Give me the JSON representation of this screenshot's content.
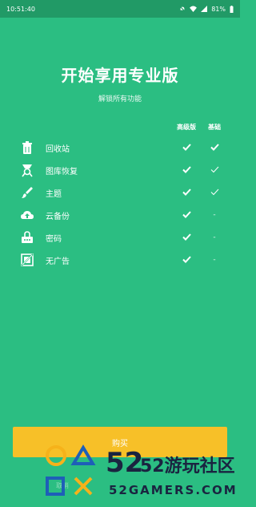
{
  "status_bar": {
    "time": "10:51:40",
    "battery": "81%"
  },
  "header": {
    "title": "开始享用专业版",
    "subtitle": "解锁所有功能"
  },
  "columns": {
    "pro": "高级版",
    "basic": "基础"
  },
  "features": [
    {
      "label": "回收站",
      "icon": "trash-icon",
      "pro": "check",
      "basic": "check"
    },
    {
      "label": "图库恢复",
      "icon": "restore-photo-icon",
      "pro": "check",
      "basic": "check-light"
    },
    {
      "label": "主题",
      "icon": "brush-icon",
      "pro": "check",
      "basic": "check-light"
    },
    {
      "label": "云备份",
      "icon": "cloud-upload-icon",
      "pro": "check",
      "basic": "-"
    },
    {
      "label": "密码",
      "icon": "lock-icon",
      "pro": "check",
      "basic": "-"
    },
    {
      "label": "无广告",
      "icon": "no-ads-icon",
      "pro": "check",
      "basic": "-"
    }
  ],
  "cta": {
    "label": "购买"
  },
  "footer": {
    "text": "取消"
  },
  "watermark": {
    "brand": "52游玩社区",
    "domain": "52GAMERS.COM",
    "number": "52"
  },
  "colors": {
    "background": "#2bbe82",
    "status_bar": "#219a66",
    "cta": "#f7c028"
  }
}
